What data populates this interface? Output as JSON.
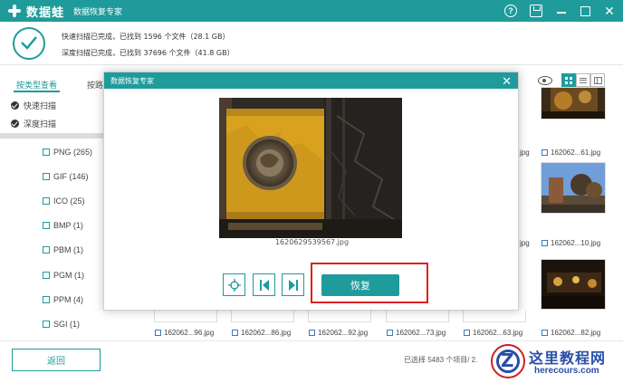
{
  "app": {
    "name": "数据蛙",
    "subtitle": "数据恢复专家"
  },
  "status": {
    "quick_scan": "快速扫描已完成，已找到 1596 个文件（28.1 GB）",
    "deep_scan": "深度扫描已完成，已找到 37696 个文件（41.8 GB）"
  },
  "tabs": [
    {
      "label": "按类型查看"
    },
    {
      "label": "按路"
    }
  ],
  "sidebar": {
    "scans": [
      {
        "label": "快速扫描"
      },
      {
        "label": "深度扫描"
      }
    ],
    "file_types": [
      {
        "label": "PNG (265)"
      },
      {
        "label": "GIF (146)"
      },
      {
        "label": "ICO (25)"
      },
      {
        "label": "BMP (1)"
      },
      {
        "label": "PBM (1)"
      },
      {
        "label": "PGM (1)"
      },
      {
        "label": "PPM (4)"
      },
      {
        "label": "SGI (1)"
      }
    ]
  },
  "grid": {
    "right_column": [
      {
        "name": "162062...61.jpg"
      },
      {
        "name": "162062...10.jpg"
      },
      {
        "name": "162062...82.jpg"
      }
    ],
    "bottom_row": [
      {
        "name": "162062...96.jpg"
      },
      {
        "name": "162062...86.jpg"
      },
      {
        "name": "162062...92.jpg"
      },
      {
        "name": "162062...73.jpg"
      },
      {
        "name": "162062...63.jpg"
      }
    ],
    "partial_labels": [
      {
        "name": "jpg"
      },
      {
        "name": "jpg"
      }
    ]
  },
  "modal": {
    "title": "数据恢复专家",
    "filename": "1620629539567.jpg",
    "recover_label": "恢复"
  },
  "footer": {
    "back_label": "返回",
    "selection": "已选择 5483 个项目/ 2."
  },
  "watermark": {
    "title": "这里教程网",
    "url": "herecours.com"
  },
  "colors": {
    "accent": "#1f9b9b",
    "highlight": "#e02020"
  }
}
